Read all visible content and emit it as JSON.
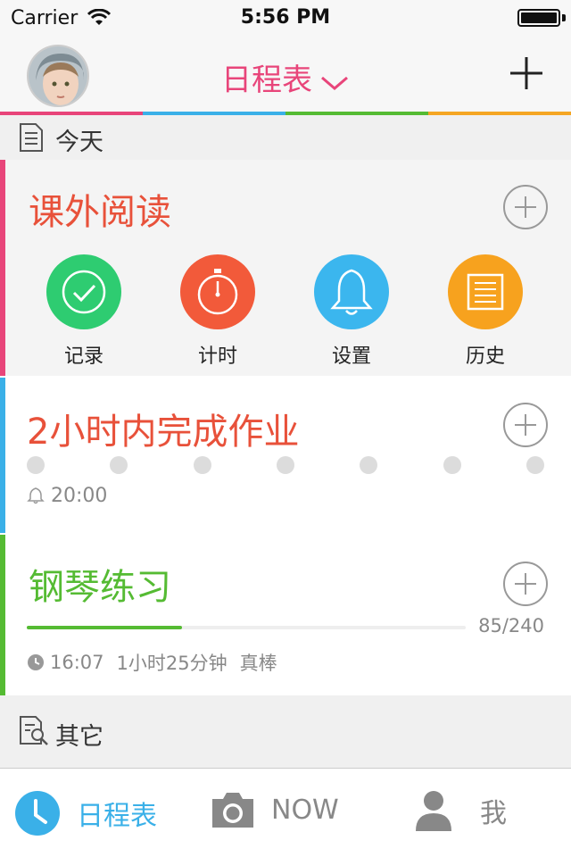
{
  "status_bar": {
    "carrier": "Carrier",
    "time": "5:56 PM"
  },
  "nav": {
    "title": "日程表",
    "avatar_icon": "avatar-child-photo",
    "add_icon": "plus-icon"
  },
  "colors": {
    "pink": "#e8457a",
    "blue": "#3ab0e8",
    "green": "#55bb33",
    "orange": "#f5a623",
    "red": "#e8513a"
  },
  "sections": {
    "today": "今天",
    "other": "其它"
  },
  "cards": {
    "reading": {
      "title": "课外阅读",
      "actions": [
        {
          "label": "记录",
          "icon": "check-icon",
          "color": "#2ecc71"
        },
        {
          "label": "计时",
          "icon": "stopwatch-icon",
          "color": "#f25a3a"
        },
        {
          "label": "设置",
          "icon": "bell-icon",
          "color": "#3bb6ee"
        },
        {
          "label": "历史",
          "icon": "list-icon",
          "color": "#f7a21e"
        }
      ]
    },
    "homework": {
      "title": "2小时内完成作业",
      "alarm_time": "20:00",
      "dot_count": 7
    },
    "piano": {
      "title": "钢琴练习",
      "progress_text": "85/240",
      "progress_fraction": 0.354,
      "start_time": "16:07",
      "duration": "1小时25分钟",
      "praise": "真棒"
    }
  },
  "tab_bar": {
    "tabs": [
      {
        "label": "日程表",
        "icon": "clock-icon",
        "active": true
      },
      {
        "label": "NOW",
        "icon": "camera-icon",
        "active": false
      },
      {
        "label": "我",
        "icon": "person-icon",
        "active": false
      }
    ]
  }
}
